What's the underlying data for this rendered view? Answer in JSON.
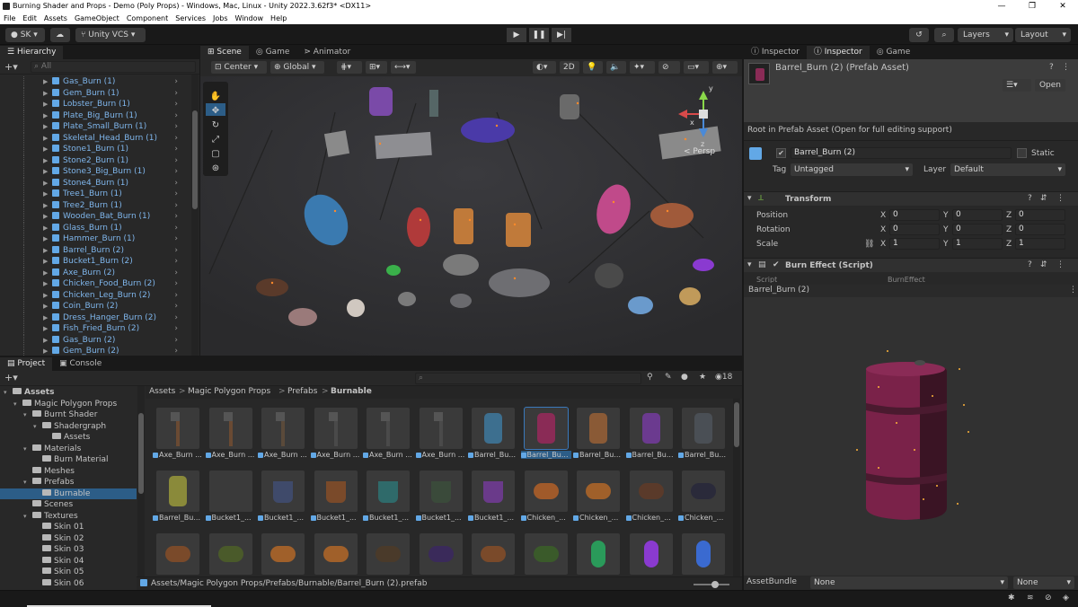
{
  "window": {
    "title": "Burning Shader and Props - Demo (Poly Props) - Windows, Mac, Linux - Unity 2022.3.62f3* <DX11>",
    "controls": [
      "—",
      "❐",
      "✕"
    ]
  },
  "menu": [
    "File",
    "Edit",
    "Assets",
    "GameObject",
    "Component",
    "Services",
    "Jobs",
    "Window",
    "Help"
  ],
  "toolbar": {
    "account": "SK",
    "vcs": "Unity VCS",
    "layers": "Layers",
    "layout": "Layout"
  },
  "hierarchy": {
    "tab": "Hierarchy",
    "search_placeholder": "All",
    "items": [
      "Gas_Burn (1)",
      "Gem_Burn (1)",
      "Lobster_Burn (1)",
      "Plate_Big_Burn (1)",
      "Plate_Small_Burn (1)",
      "Skeletal_Head_Burn (1)",
      "Stone1_Burn (1)",
      "Stone2_Burn (1)",
      "Stone3_Big_Burn (1)",
      "Stone4_Burn (1)",
      "Tree1_Burn (1)",
      "Tree2_Burn (1)",
      "Wooden_Bat_Burn (1)",
      "Glass_Burn (1)",
      "Hammer_Burn (1)",
      "Barrel_Burn (2)",
      "Bucket1_Burn (2)",
      "Axe_Burn (2)",
      "Chicken_Food_Burn (2)",
      "Chicken_Leg_Burn (2)",
      "Coin_Burn (2)",
      "Dress_Hanger_Burn (2)",
      "Fish_Fried_Burn (2)",
      "Gas_Burn (2)",
      "Gem_Burn (2)"
    ]
  },
  "scene": {
    "tabs": [
      "Scene",
      "Game",
      "Animator"
    ],
    "center": "Center",
    "global": "Global",
    "mode2d": "2D",
    "persp": "< Persp",
    "axes": {
      "x": "x",
      "y": "y",
      "z": "z"
    }
  },
  "inspector": {
    "tabs": [
      "Inspector",
      "Inspector",
      "Game"
    ],
    "asset_title": "Barrel_Burn (2) (Prefab Asset)",
    "open": "Open",
    "root_note": "Root in Prefab Asset (Open for full editing support)",
    "object_name": "Barrel_Burn (2)",
    "static": "Static",
    "tag_label": "Tag",
    "tag_value": "Untagged",
    "layer_label": "Layer",
    "layer_value": "Default",
    "transform": "Transform",
    "position": "Position",
    "rotation": "Rotation",
    "scale": "Scale",
    "pos": [
      "0",
      "0",
      "0"
    ],
    "rot": [
      "0",
      "0",
      "0"
    ],
    "scl": [
      "1",
      "1",
      "1"
    ],
    "axis": [
      "X",
      "Y",
      "Z"
    ],
    "burn_effect": "Burn Effect (Script)",
    "script_label": "Script",
    "script_value": "BurnEffect",
    "preview_title": "Barrel_Burn (2)",
    "assetbundle_label": "AssetBundle",
    "assetbundle_value": "None",
    "assetbundle_variant": "None"
  },
  "project": {
    "tabs": [
      "Project",
      "Console"
    ],
    "count": "18",
    "breadcrumb": [
      "Assets",
      "Magic Polygon Props",
      "Prefabs",
      "Burnable"
    ],
    "path": "Assets/Magic Polygon Props/Prefabs/Burnable/Barrel_Burn (2).prefab",
    "tree": [
      {
        "label": "Assets",
        "depth": 0,
        "bold": true
      },
      {
        "label": "Magic Polygon Props",
        "depth": 1
      },
      {
        "label": "Burnt Shader",
        "depth": 2
      },
      {
        "label": "Shadergraph",
        "depth": 3
      },
      {
        "label": "Assets",
        "depth": 4
      },
      {
        "label": "Materials",
        "depth": 2
      },
      {
        "label": "Burn Material",
        "depth": 3
      },
      {
        "label": "Meshes",
        "depth": 2
      },
      {
        "label": "Prefabs",
        "depth": 2
      },
      {
        "label": "Burnable",
        "depth": 3,
        "selected": true
      },
      {
        "label": "Scenes",
        "depth": 2
      },
      {
        "label": "Textures",
        "depth": 2
      },
      {
        "label": "Skin 01",
        "depth": 3
      },
      {
        "label": "Skin 02",
        "depth": 3
      },
      {
        "label": "Skin 03",
        "depth": 3
      },
      {
        "label": "Skin 04",
        "depth": 3
      },
      {
        "label": "Skin 05",
        "depth": 3
      },
      {
        "label": "Skin 06",
        "depth": 3
      }
    ],
    "assets": [
      {
        "label": "Axe_Burn ...",
        "color": "#6a4a33",
        "shape": "axe"
      },
      {
        "label": "Axe_Burn ...",
        "color": "#6a4a33",
        "shape": "axe"
      },
      {
        "label": "Axe_Burn ...",
        "color": "#5a4a3a",
        "shape": "axe"
      },
      {
        "label": "Axe_Burn ...",
        "color": "#4a4a4a",
        "shape": "axe"
      },
      {
        "label": "Axe_Burn ...",
        "color": "#4a4a4a",
        "shape": "axe"
      },
      {
        "label": "Axe_Burn ...",
        "color": "#4a4a4a",
        "shape": "axe"
      },
      {
        "label": "Barrel_Bu...",
        "color": "#3d6f8f",
        "shape": "barrel"
      },
      {
        "label": "Barrel_Bu...",
        "color": "#8a2b56",
        "shape": "barrel",
        "selected": true
      },
      {
        "label": "Barrel_Bu...",
        "color": "#8a5a36",
        "shape": "barrel"
      },
      {
        "label": "Barrel_Bu...",
        "color": "#6b3a8f",
        "shape": "barrel"
      },
      {
        "label": "Barrel_Bu...",
        "color": "#4a4f55",
        "shape": "barrel"
      },
      {
        "label": "Barrel_Bu...",
        "color": "#8a8a3a",
        "shape": "barrel"
      },
      {
        "label": "Bucket1_...",
        "color": "#3a3a3a",
        "shape": "bucket"
      },
      {
        "label": "Bucket1_...",
        "color": "#3f4a6a",
        "shape": "bucket"
      },
      {
        "label": "Bucket1_...",
        "color": "#7a4a2a",
        "shape": "bucket"
      },
      {
        "label": "Bucket1_...",
        "color": "#2f6a6a",
        "shape": "bucket"
      },
      {
        "label": "Bucket1_...",
        "color": "#3a4a3a",
        "shape": "bucket"
      },
      {
        "label": "Bucket1_...",
        "color": "#6a3a8a",
        "shape": "bucket"
      },
      {
        "label": "Chicken_...",
        "color": "#a05a2a",
        "shape": "blob"
      },
      {
        "label": "Chicken_...",
        "color": "#a0602a",
        "shape": "blob"
      },
      {
        "label": "Chicken_...",
        "color": "#5a3a2a",
        "shape": "blob"
      },
      {
        "label": "Chicken_...",
        "color": "#2a2a3a",
        "shape": "blob"
      },
      {
        "label": "",
        "color": "#7a4a2a",
        "shape": "blob"
      },
      {
        "label": "",
        "color": "#4a5a2a",
        "shape": "blob"
      },
      {
        "label": "",
        "color": "#a0602a",
        "shape": "blob"
      },
      {
        "label": "",
        "color": "#a0602a",
        "shape": "blob"
      },
      {
        "label": "",
        "color": "#4a3a2a",
        "shape": "blob"
      },
      {
        "label": "",
        "color": "#3a2a5a",
        "shape": "blob"
      },
      {
        "label": "",
        "color": "#7a4a2a",
        "shape": "blob"
      },
      {
        "label": "",
        "color": "#3a5a2a",
        "shape": "blob"
      },
      {
        "label": "",
        "color": "#2a9a5a",
        "shape": "gem"
      },
      {
        "label": "",
        "color": "#8a3ad0",
        "shape": "gem"
      },
      {
        "label": "",
        "color": "#3a6ad0",
        "shape": "gem"
      }
    ]
  }
}
